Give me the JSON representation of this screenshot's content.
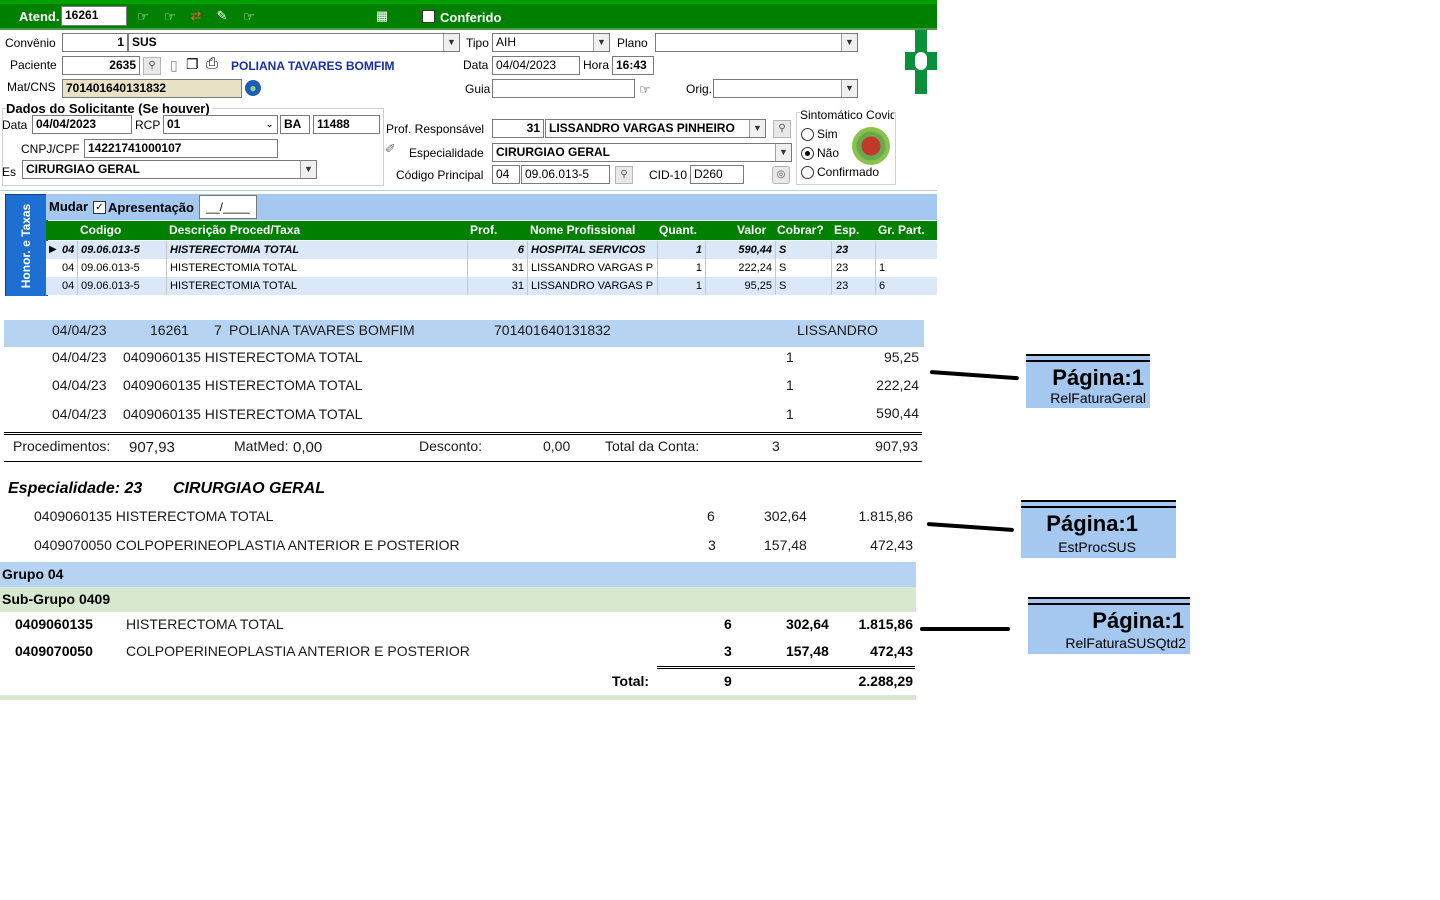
{
  "toolbar": {
    "atend_label": "Atend.",
    "atend_value": "16261",
    "conferido_label": "Conferido",
    "bg_color": "#008000"
  },
  "form": {
    "convenio_label": "Convênio",
    "convenio_code": "1",
    "convenio_name": "SUS",
    "tipo_label": "Tipo",
    "tipo_value": "AIH",
    "plano_label": "Plano",
    "plano_value": "",
    "paciente_label": "Paciente",
    "paciente_code": "2635",
    "paciente_name": "POLIANA TAVARES BOMFIM",
    "data_label": "Data",
    "data_value": "04/04/2023",
    "hora_label": "Hora",
    "hora_value": "16:43",
    "matcns_label": "Mat/CNS",
    "matcns_value": "701401640131832",
    "guia_label": "Guia",
    "guia_value": "",
    "orig_label": "Orig.",
    "orig_value": "",
    "solicitante_title": "Dados do Solicitante (Se houver)",
    "sol_data_label": "Data",
    "sol_data_value": "04/04/2023",
    "rcp_label": "RCP",
    "rcp_value": "01",
    "uf_value": "BA",
    "crm_value": "11488",
    "cnpj_label": "CNPJ/CPF",
    "cnpj_value": "14221741000107",
    "esp_label": "Es",
    "esp_value": "CIRURGIAO GERAL",
    "prof_resp_label": "Prof. Responsável",
    "prof_resp_code": "31",
    "prof_resp_name": "LISSANDRO VARGAS PINHEIRO",
    "especialidade_label": "Especialidade",
    "especialidade_value": "CIRURGIAO GERAL",
    "cod_principal_label": "Código Principal",
    "cod_principal_group": "04",
    "cod_principal_value": "09.06.013-5",
    "cid_label": "CID-10",
    "cid_value": "D260",
    "covid_title": "Sintomático Covid",
    "covid_options": [
      "Sim",
      "Não",
      "Confirmado"
    ],
    "covid_selected": "Não"
  },
  "grid": {
    "side_tab": "Honor. e Taxas",
    "mudar_label": "Mudar",
    "apresentacao_label": "Apresentação",
    "apresentacao_value": "__/____",
    "headers": [
      "Codigo",
      "Descrição Proced/Taxa",
      "Prof.",
      "Nome Profissional",
      "Quant.",
      "Valor",
      "Cobrar?",
      "Esp.",
      "Gr. Part."
    ],
    "rows": [
      {
        "grp": "04",
        "codigo": "09.06.013-5",
        "descricao": "HISTERECTOMIA TOTAL",
        "prof": "6",
        "nome": "HOSPITAL SERVICOS",
        "quant": "1",
        "valor": "590,44",
        "cobrar": "S",
        "esp": "23",
        "grpart": ""
      },
      {
        "grp": "04",
        "codigo": "09.06.013-5",
        "descricao": "HISTERECTOMIA TOTAL",
        "prof": "31",
        "nome": "LISSANDRO VARGAS P",
        "quant": "1",
        "valor": "222,24",
        "cobrar": "S",
        "esp": "23",
        "grpart": "1"
      },
      {
        "grp": "04",
        "codigo": "09.06.013-5",
        "descricao": "HISTERECTOMIA TOTAL",
        "prof": "31",
        "nome": "LISSANDRO VARGAS P",
        "quant": "1",
        "valor": "95,25",
        "cobrar": "S",
        "esp": "23",
        "grpart": "6"
      }
    ]
  },
  "report1": {
    "header": {
      "date": "04/04/23",
      "atend": "16261",
      "n": "7",
      "name": "POLIANA TAVARES BOMFIM",
      "cns": "701401640131832",
      "prof": "LISSANDRO"
    },
    "lines": [
      {
        "date": "04/04/23",
        "proc": "0409060135 HISTERECTOMA TOTAL",
        "q": "1",
        "v": "95,25"
      },
      {
        "date": "04/04/23",
        "proc": "0409060135 HISTERECTOMA TOTAL",
        "q": "1",
        "v": "222,24"
      },
      {
        "date": "04/04/23",
        "proc": "0409060135 HISTERECTOMA TOTAL",
        "q": "1",
        "v": "590,44"
      }
    ],
    "totals": {
      "proc_label": "Procedimentos:",
      "proc_value": "907,93",
      "matmed_label": "MatMed:",
      "matmed_value": "0,00",
      "desconto_label": "Desconto:",
      "desconto_value": "0,00",
      "total_label": "Total da Conta:",
      "total_count": "3",
      "total_value": "907,93"
    },
    "badge_title": "Página:1",
    "badge_name": "RelFaturaGeral"
  },
  "report2": {
    "title": "Especialidade: 23",
    "title_name": "CIRURGIAO GERAL",
    "lines": [
      {
        "proc": "0409060135 HISTERECTOMA TOTAL",
        "q": "6",
        "unit": "302,64",
        "total": "1.815,86"
      },
      {
        "proc": "0409070050 COLPOPERINEOPLASTIA ANTERIOR E POSTERIOR",
        "q": "3",
        "unit": "157,48",
        "total": "472,43"
      }
    ],
    "badge_title": "Página:1",
    "badge_name": "EstProcSUS"
  },
  "report3": {
    "group_label": "Grupo 04",
    "subgroup_label": "Sub-Grupo 0409",
    "lines": [
      {
        "code": "0409060135",
        "desc": "HISTERECTOMA TOTAL",
        "q": "6",
        "unit": "302,64",
        "total": "1.815,86"
      },
      {
        "code": "0409070050",
        "desc": "COLPOPERINEOPLASTIA ANTERIOR E POSTERIOR",
        "q": "3",
        "unit": "157,48",
        "total": "472,43"
      }
    ],
    "total_label": "Total:",
    "total_q": "9",
    "total_value": "2.288,29",
    "badge_title": "Página:1",
    "badge_name": "RelFaturaSUSQtd2"
  },
  "colors": {
    "green": "#008000",
    "grid_header": "#008000",
    "light_blue": "#a4c8ef",
    "row_blue": "#dbe8f8",
    "group_blue": "#b7d3f2",
    "subgroup_green": "#d8e8cf"
  }
}
